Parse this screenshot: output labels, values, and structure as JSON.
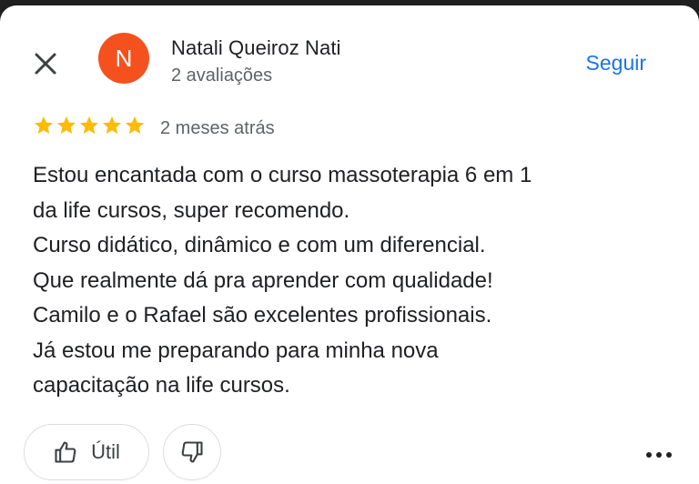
{
  "reviewer": {
    "initial": "N",
    "name": "Natali Queiroz Nati",
    "reviews_count": "2 avaliações",
    "avatar_color": "#f4511e"
  },
  "header": {
    "follow_label": "Seguir",
    "close_icon": "close-icon"
  },
  "review": {
    "rating": 5,
    "max_rating": 5,
    "star_color": "#fbbc04",
    "date": "2 meses atrás",
    "lines": [
      "Estou encantada com o curso massoterapia 6 em 1",
      "da life cursos, super recomendo.",
      "Curso didático, dinâmico e com um diferencial.",
      "Que realmente dá pra aprender com qualidade!",
      "Camilo e o Rafael são excelentes profissionais.",
      "Já estou me preparando para minha nova",
      "capacitação na life cursos."
    ]
  },
  "actions": {
    "helpful_label": "Útil",
    "helpful_icon": "thumbs-up-icon",
    "unhelpful_icon": "thumbs-down-icon",
    "more_icon": "more-horizontal-icon"
  },
  "colors": {
    "accent": "#1a73e8",
    "text_primary": "#202124",
    "text_secondary": "#5f6368"
  }
}
